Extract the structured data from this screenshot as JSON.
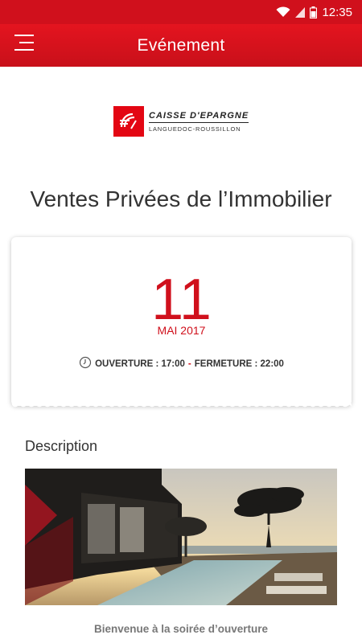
{
  "status_bar": {
    "time": "12:35",
    "icons": [
      "wifi-icon",
      "signal-icon",
      "battery-icon"
    ]
  },
  "app_bar": {
    "title": "Evénement",
    "menu_icon": "menu-icon"
  },
  "logo": {
    "brand": "CAISSE D'EPARGNE",
    "region": "LANGUEDOC-ROUSSILLON",
    "icon": "squirrel-logo-icon"
  },
  "event": {
    "title": "Ventes Privées de l’Immobilier",
    "day": "11",
    "month_year": "MAI 2017",
    "opening": "OUVERTURE : 17:00",
    "separator": "-",
    "closing": "FERMETURE : 22:00",
    "clock_icon": "clock-icon"
  },
  "description": {
    "label": "Description",
    "welcome": "Bienvenue à la soirée d’ouverture"
  },
  "colors": {
    "primary_red": "#d0101c",
    "text_dark": "#333333"
  }
}
